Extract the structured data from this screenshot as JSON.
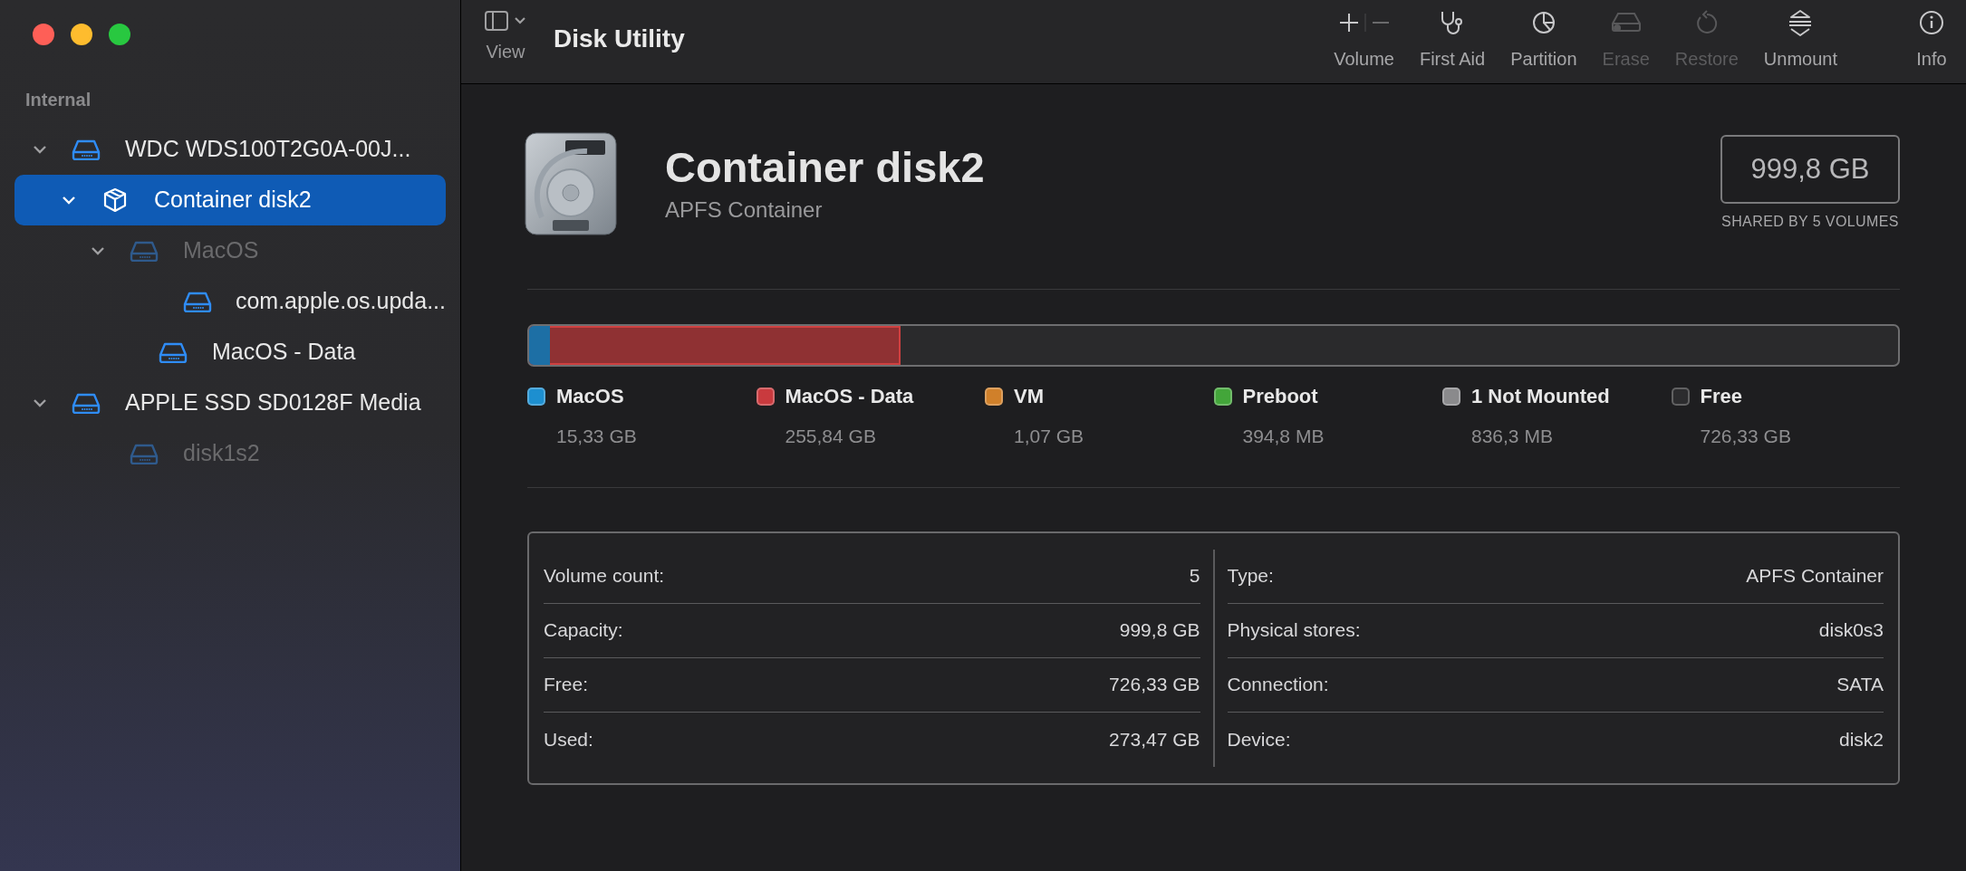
{
  "sidebar": {
    "section": "Internal",
    "items": [
      {
        "label": "WDC WDS100T2G0A-00J...",
        "kind": "drive",
        "expanded": true,
        "selected": false,
        "mounted": true,
        "children": [
          {
            "label": "Container disk2",
            "kind": "container",
            "expanded": true,
            "selected": true,
            "mounted": true,
            "children": [
              {
                "label": "MacOS",
                "kind": "drive",
                "expanded": true,
                "selected": false,
                "mounted": false,
                "children": [
                  {
                    "label": "com.apple.os.upda...",
                    "kind": "drive",
                    "selected": false,
                    "mounted": true
                  }
                ]
              },
              {
                "label": "MacOS - Data",
                "kind": "drive",
                "selected": false,
                "mounted": true
              }
            ]
          }
        ]
      },
      {
        "label": "APPLE SSD SD0128F Media",
        "kind": "drive",
        "expanded": true,
        "selected": false,
        "mounted": true,
        "children": [
          {
            "label": "disk1s2",
            "kind": "drive",
            "selected": false,
            "mounted": false
          }
        ]
      }
    ]
  },
  "toolbar": {
    "view_label": "View",
    "title": "Disk Utility",
    "actions": [
      {
        "kind": "volume",
        "label": "Volume",
        "disabled": false
      },
      {
        "kind": "first_aid",
        "label": "First Aid",
        "disabled": false
      },
      {
        "kind": "partition",
        "label": "Partition",
        "disabled": false
      },
      {
        "kind": "erase",
        "label": "Erase",
        "disabled": true
      },
      {
        "kind": "restore",
        "label": "Restore",
        "disabled": true
      },
      {
        "kind": "unmount",
        "label": "Unmount",
        "disabled": false
      },
      {
        "kind": "info",
        "label": "Info",
        "disabled": false
      }
    ]
  },
  "header": {
    "title": "Container disk2",
    "subtitle": "APFS Container",
    "capacity": "999,8 GB",
    "shared_note": "SHARED BY 5 VOLUMES"
  },
  "usage_bar": {
    "segments": [
      {
        "color": "#1d6fa5",
        "level": 0.0153
      },
      {
        "color": "#8f3133",
        "level": 0.2712
      }
    ]
  },
  "legend": [
    {
      "name": "MacOS",
      "size": "15,33 GB",
      "color": "#1d8fd0"
    },
    {
      "name": "MacOS - Data",
      "size": "255,84 GB",
      "color": "#c93a3e"
    },
    {
      "name": "VM",
      "size": "1,07 GB",
      "color": "#d0802a"
    },
    {
      "name": "Preboot",
      "size": "394,8 MB",
      "color": "#43a63a"
    },
    {
      "name": "1 Not Mounted",
      "size": "836,3 MB",
      "color": "#8a8a8c"
    },
    {
      "name": "Free",
      "size": "726,33 GB",
      "color": "#2c2c2e"
    }
  ],
  "info_table": {
    "left": [
      {
        "label": "Volume count:",
        "value": "5"
      },
      {
        "label": "Capacity:",
        "value": "999,8 GB"
      },
      {
        "label": "Free:",
        "value": "726,33 GB"
      },
      {
        "label": "Used:",
        "value": "273,47 GB"
      }
    ],
    "right": [
      {
        "label": "Type:",
        "value": "APFS Container"
      },
      {
        "label": "Physical stores:",
        "value": "disk0s3"
      },
      {
        "label": "Connection:",
        "value": "SATA"
      },
      {
        "label": "Device:",
        "value": "disk2"
      }
    ]
  }
}
